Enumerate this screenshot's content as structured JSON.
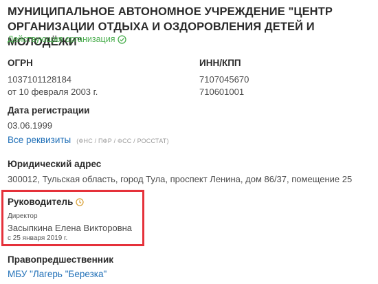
{
  "org": {
    "title": "МУНИЦИПАЛЬНОЕ АВТОНОМНОЕ УЧРЕЖДЕНИЕ \"ЦЕНТР ОРГАНИЗАЦИИ ОТДЫХА И ОЗДОРОВЛЕНИЯ ДЕТЕЙ И МОЛОДЁЖИ\"",
    "status": "Действующая организация",
    "status_color": "#4caf50"
  },
  "ogrn": {
    "label": "ОГРН",
    "number": "1037101128184",
    "date": "от 10 февраля 2003 г."
  },
  "inn": {
    "label": "ИНН/КПП",
    "inn": "7107045670",
    "kpp": "710601001"
  },
  "registration": {
    "label": "Дата регистрации",
    "date": "03.06.1999",
    "all_details_link": "Все реквизиты",
    "sources": "(ФНС / ПФР / ФСС / РОССТАТ)"
  },
  "address": {
    "label": "Юридический адрес",
    "value": "300012, Тульская область, город Тула, проспект Ленина, дом 86/37, помещение 25"
  },
  "head": {
    "label": "Руководитель",
    "position": "Директор",
    "name": "Засыпкина Елена Викторовна",
    "since": "с 25 января 2019 г.",
    "highlight_color": "#e5313a"
  },
  "predecessor": {
    "label": "Правопредшественник",
    "link": "МБУ \"Лагерь \"Березка\""
  },
  "link_color": "#1f6fb7"
}
